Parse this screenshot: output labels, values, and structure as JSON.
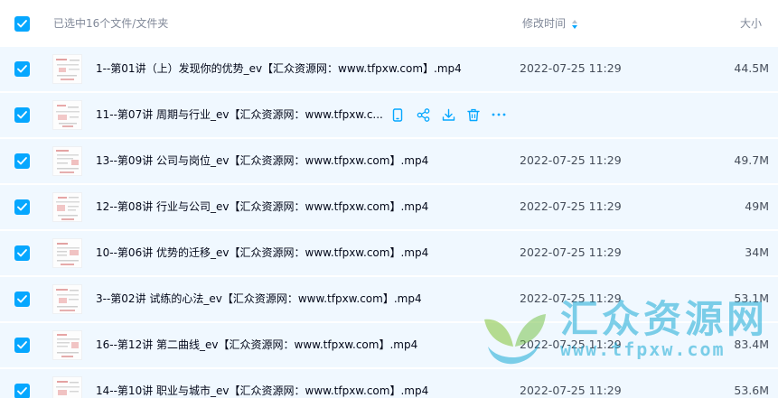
{
  "header": {
    "selection_label": "已选中16个文件/文件夹",
    "modified_label": "修改时间",
    "size_label": "大小"
  },
  "colors": {
    "accent": "#06a7ff",
    "row_background": "#f0f8ff",
    "header_text": "#818999",
    "watermark": "#1aaad6"
  },
  "files": [
    {
      "name": "1--第01讲（上）发现你的优势_ev【汇众资源网：www.tfpxw.com】.mp4",
      "modified": "2022-07-25 11:29",
      "size": "44.5M"
    },
    {
      "name": "11--第07讲 周期与行业_ev【汇众资源网：www.tfpxw.c...",
      "modified": "",
      "size": "",
      "hovered": true
    },
    {
      "name": "13--第09讲 公司与岗位_ev【汇众资源网：www.tfpxw.com】.mp4",
      "modified": "2022-07-25 11:29",
      "size": "49.7M"
    },
    {
      "name": "12--第08讲 行业与公司_ev【汇众资源网：www.tfpxw.com】.mp4",
      "modified": "2022-07-25 11:29",
      "size": "49M"
    },
    {
      "name": "10--第06讲 优势的迁移_ev【汇众资源网：www.tfpxw.com】.mp4",
      "modified": "2022-07-25 11:29",
      "size": "34M"
    },
    {
      "name": "3--第02讲 试练的心法_ev【汇众资源网：www.tfpxw.com】.mp4",
      "modified": "2022-07-25 11:29",
      "size": "53.1M"
    },
    {
      "name": "16--第12讲 第二曲线_ev【汇众资源网：www.tfpxw.com】.mp4",
      "modified": "2022-07-25 11:29",
      "size": "83.4M"
    },
    {
      "name": "14--第10讲 职业与城市_ev【汇众资源网：www.tfpxw.com】.mp4",
      "modified": "2022-07-25 11:29",
      "size": "53.6M"
    }
  ],
  "row_actions": [
    "phone-icon",
    "share-icon",
    "download-icon",
    "trash-icon",
    "more-icon"
  ],
  "watermark": {
    "title": "汇众资源网",
    "url": "www.tfpxw.com"
  }
}
